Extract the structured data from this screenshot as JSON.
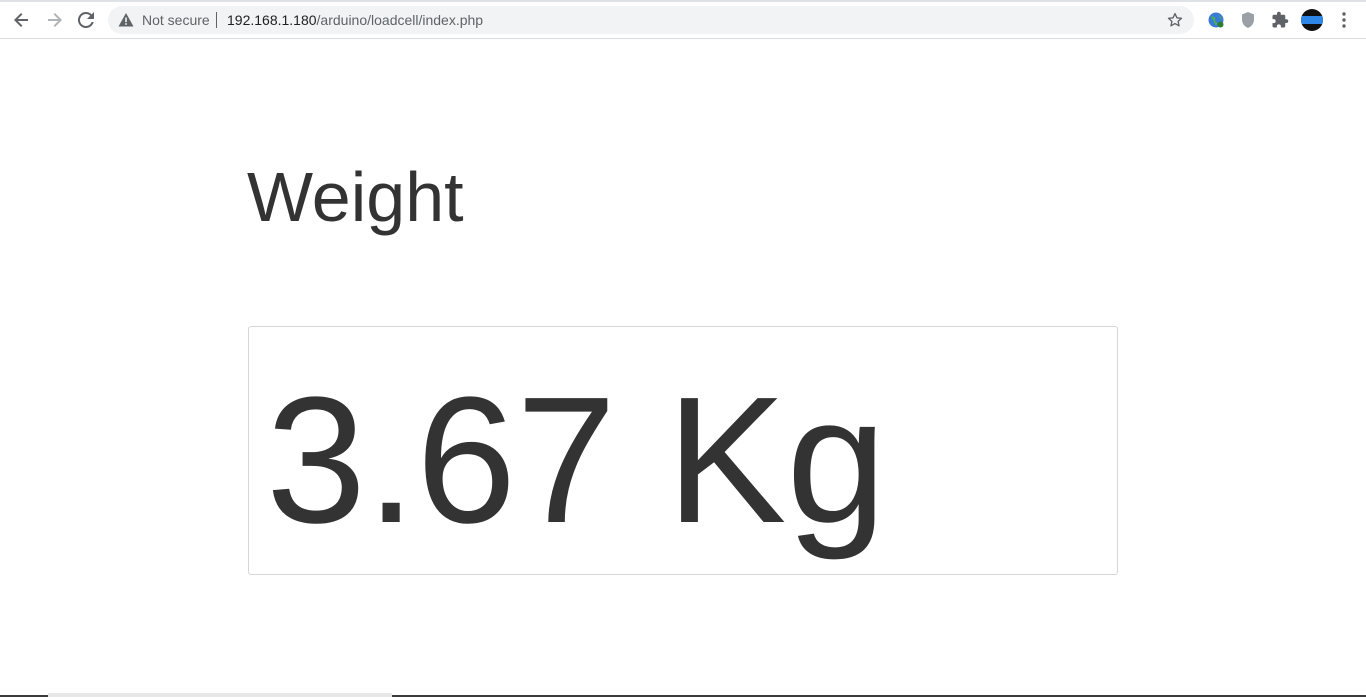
{
  "browser": {
    "security_label": "Not secure",
    "url_host": "192.168.1.180",
    "url_path": "/arduino/loadcell/index.php",
    "icons": {
      "back": "arrow-left-icon",
      "forward": "arrow-right-icon",
      "reload": "reload-icon",
      "warning": "warning-triangle-icon",
      "bookmark": "star-icon",
      "extension_1": "globe-icon",
      "extension_2": "shield-icon",
      "extensions": "puzzle-icon",
      "profile": "avatar",
      "menu": "kebab-menu-icon"
    }
  },
  "page": {
    "title": "Weight",
    "reading": "3.67 Kg"
  },
  "colors": {
    "text": "#333333",
    "well_border": "#d6d6d6",
    "omnibox_bg": "#f1f3f4"
  }
}
